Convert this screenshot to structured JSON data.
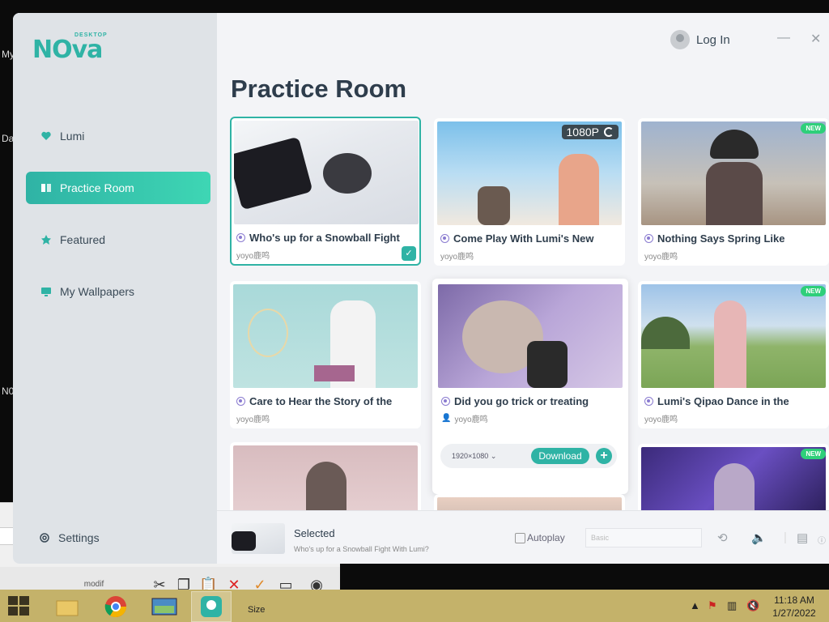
{
  "desktop": {
    "labels": [
      "My",
      "Da",
      "N0"
    ],
    "bg_toolbar_label": "modif",
    "bg_size_label": "Size"
  },
  "app": {
    "logo_main": "NOva",
    "logo_sub": "DESKTOP",
    "login_label": "Log In",
    "minimize_icon": "—",
    "close_icon": "✕",
    "page_title": "Practice Room"
  },
  "sidebar": {
    "items": [
      {
        "label": "Lumi",
        "icon": "heart-icon"
      },
      {
        "label": "Practice Room",
        "icon": "book-icon",
        "active": true
      },
      {
        "label": "Featured",
        "icon": "star-icon"
      },
      {
        "label": "My Wallpapers",
        "icon": "monitor-icon"
      }
    ],
    "settings_label": "Settings"
  },
  "cards": [
    {
      "title": "Who's up for a Snowball Fight",
      "author": "yoyo鹿鸣",
      "selected": true
    },
    {
      "title": "Come Play With Lumi's New",
      "author": "yoyo鹿鸣",
      "badge": "1080P"
    },
    {
      "title": "Nothing Says Spring Like",
      "author": "yoyo鹿鸣",
      "badge": "NEW"
    },
    {
      "title": "Care to Hear the Story of the",
      "author": "yoyo鹿鸣"
    },
    {
      "title": "Did you go trick or treating",
      "author": "yoyo鹿鸣",
      "expanded": true
    },
    {
      "title": "Lumi's Qipao Dance in the",
      "author": "yoyo鹿鸣",
      "badge": "NEW"
    },
    {
      "title": "",
      "author": ""
    },
    {
      "title": "",
      "author": ""
    },
    {
      "title": "",
      "author": "",
      "badge": "NEW"
    }
  ],
  "download": {
    "resolution": "1920×1080",
    "button_label": "Download",
    "plus_label": "+"
  },
  "player": {
    "selected_label": "Selected",
    "selected_title": "Who's up for a Snowball Fight With Lumi?",
    "autoplay_label": "Autoplay",
    "input_placeholder": "Basic"
  },
  "taskbar": {
    "time": "11:18 AM",
    "date": "1/27/2022"
  },
  "colors": {
    "accent": "#2fb3a5",
    "sidebar": "#dfe3e7",
    "taskbar": "#c4b26a",
    "new_badge": "#2ecf7a"
  }
}
